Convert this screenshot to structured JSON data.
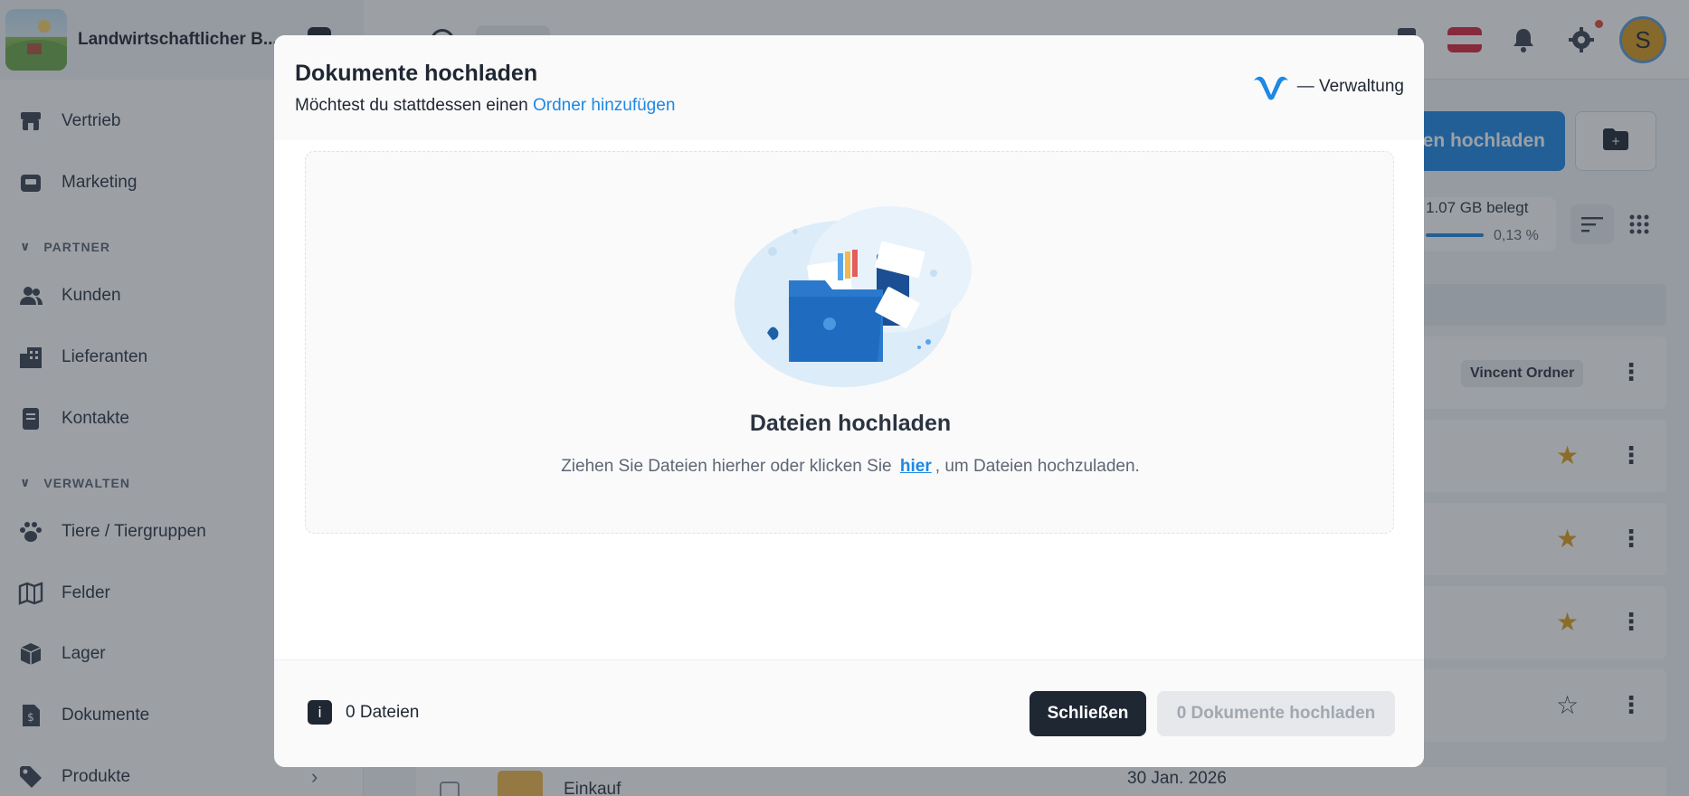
{
  "app": {
    "brand_name": "Landwirtschaftlicher B..."
  },
  "sidebar": {
    "items": [
      {
        "label": "Vertrieb",
        "icon": "storefront-icon"
      },
      {
        "label": "Marketing",
        "icon": "megaphone-icon"
      },
      {
        "label": "Kunden",
        "icon": "users-icon"
      },
      {
        "label": "Lieferanten",
        "icon": "building-icon"
      },
      {
        "label": "Kontakte",
        "icon": "address-book-icon"
      },
      {
        "label": "Tiere / Tiergruppen",
        "icon": "paw-icon"
      },
      {
        "label": "Felder",
        "icon": "map-icon"
      },
      {
        "label": "Lager",
        "icon": "box-icon"
      },
      {
        "label": "Dokumente",
        "icon": "document-icon"
      },
      {
        "label": "Produkte",
        "icon": "tag-icon"
      }
    ],
    "sections": {
      "partner": "PARTNER",
      "verwalten": "VERWALTEN"
    }
  },
  "background": {
    "upload_button_label": "en hochladen",
    "storage_used": "1.07 GB belegt",
    "storage_percent": "0,13 %",
    "storage_fraction": 0.0013,
    "owner_badge": "Vincent Ordner",
    "rows_starred": [
      true,
      true,
      true,
      false,
      false
    ],
    "bottom_row": {
      "name": "Einkauf",
      "date": "30 Jan. 2026"
    }
  },
  "modal": {
    "title": "Dokumente hochladen",
    "subtitle_prefix": "Möchtest du stattdessen einen",
    "subtitle_link": "Ordner hinzufügen",
    "brand_label": "— Verwaltung",
    "dropzone": {
      "title": "Dateien hochladen",
      "text_before": "Ziehen Sie Dateien hierher oder klicken Sie",
      "link": "hier",
      "text_after": ", um Dateien hochzuladen."
    },
    "footer": {
      "file_count": "0 Dateien",
      "close_label": "Schließen",
      "submit_label": "0 Dokumente hochladen"
    }
  },
  "colors": {
    "accent": "#1e88e5",
    "dark": "#1f2733",
    "star": "#e0a21a",
    "disabled": "#e6e8eb"
  }
}
